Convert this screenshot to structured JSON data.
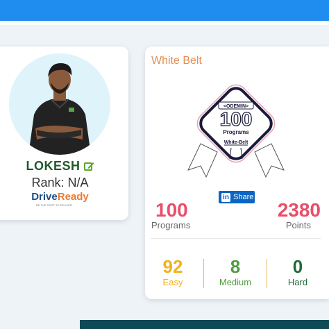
{
  "profile": {
    "name": "LOKESH",
    "rank_label": "Rank:",
    "rank_value": "N/A",
    "brand_part1": "Drive",
    "brand_part2": "Ready",
    "brand_tagline": "BE THE FIRST TO DELIVER"
  },
  "stats": {
    "belt_title": "White Belt",
    "badge": {
      "brand": "ODEMIN",
      "number": "100",
      "programs_label": "Programs",
      "belt_label": "White-Belt"
    },
    "share_label": "Share",
    "share_icon_text": "in",
    "programs_value": "100",
    "programs_label": "Programs",
    "points_value": "2380",
    "points_label": "Points",
    "easy_value": "92",
    "easy_label": "Easy",
    "medium_value": "8",
    "medium_label": "Medium",
    "hard_value": "0",
    "hard_label": "Hard"
  },
  "colors": {
    "topbar": "#1f8cf0",
    "easy": "#f2b21b",
    "medium": "#4f9d40",
    "hard": "#1f6b3a",
    "big_numbers": "#e84f6a",
    "belt_title": "#e48d4f"
  }
}
